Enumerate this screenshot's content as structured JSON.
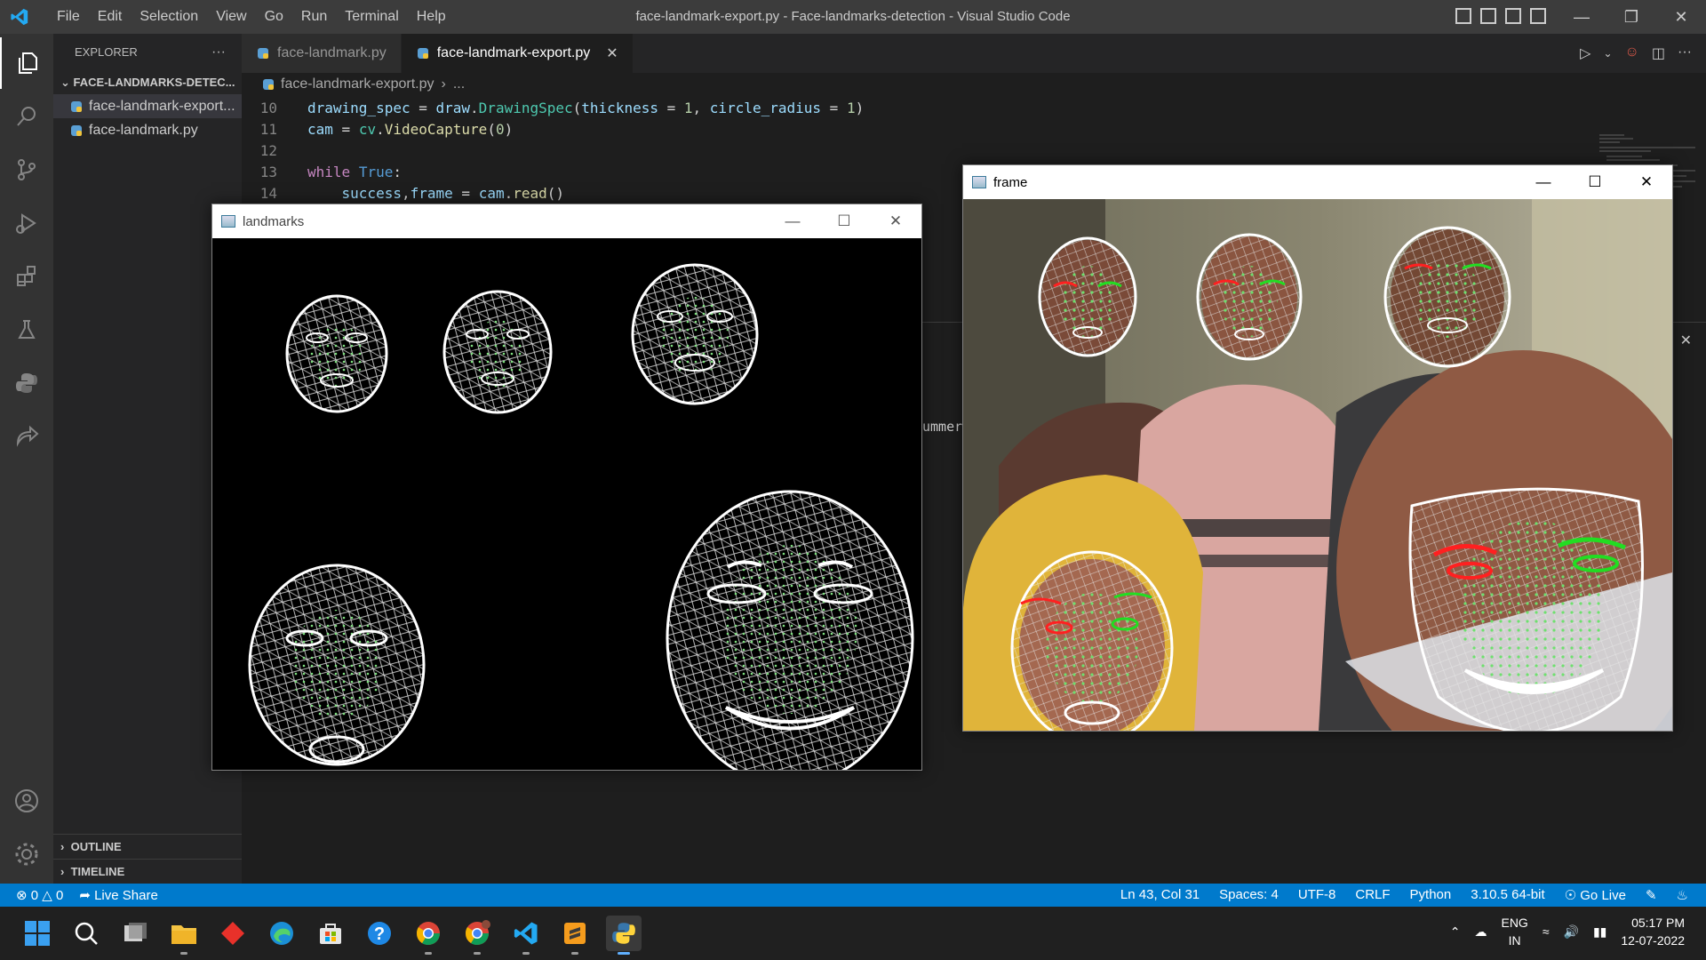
{
  "titlebar": {
    "menu": [
      "File",
      "Edit",
      "Selection",
      "View",
      "Go",
      "Run",
      "Terminal",
      "Help"
    ],
    "title": "face-landmark-export.py - Face-landmarks-detection - Visual Studio Code"
  },
  "sidebar": {
    "header": "EXPLORER",
    "folder": "FACE-LANDMARKS-DETEC...",
    "files": [
      "face-landmark-export...",
      "face-landmark.py"
    ],
    "outline": "OUTLINE",
    "timeline": "TIMELINE"
  },
  "tabs": [
    {
      "label": "face-landmark.py",
      "active": false
    },
    {
      "label": "face-landmark-export.py",
      "active": true
    }
  ],
  "breadcrumb": {
    "file": "face-landmark-export.py",
    "rest": "..."
  },
  "code": {
    "line_numbers": [
      "10",
      "11",
      "12",
      "13",
      "14"
    ]
  },
  "panel": {
    "partial_text": "ummer"
  },
  "landmarks_window": {
    "title": "landmarks"
  },
  "frame_window": {
    "title": "frame"
  },
  "statusbar": {
    "errors": "0",
    "warnings": "0",
    "live_share": "Live Share",
    "position": "Ln 43, Col 31",
    "spaces": "Spaces: 4",
    "encoding": "UTF-8",
    "eol": "CRLF",
    "language": "Python",
    "interpreter": "3.10.5 64-bit",
    "go_live": "Go Live"
  },
  "taskbar": {
    "lang": "ENG",
    "region": "IN",
    "time": "05:17 PM",
    "date": "12-07-2022",
    "icons": [
      "windows-start-icon",
      "search-icon",
      "task-view-icon",
      "file-explorer-icon",
      "app-red-icon",
      "edge-icon",
      "store-icon",
      "help-icon",
      "chrome-icon",
      "chrome-profile-icon",
      "vscode-icon",
      "sublime-icon",
      "python-icon"
    ]
  },
  "colors": {
    "statusbar": "#007acc",
    "titlebar": "#3c3c3c",
    "activitybar": "#333333",
    "sidebar": "#252526",
    "editor": "#1e1e1e"
  }
}
